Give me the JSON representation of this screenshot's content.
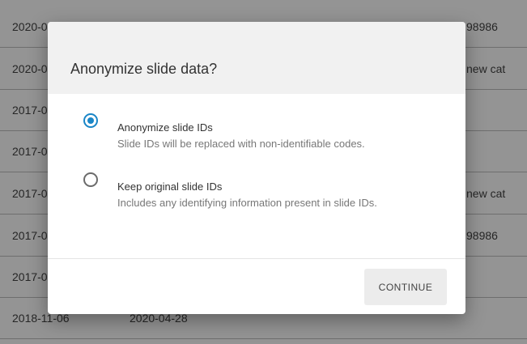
{
  "background_table": {
    "rows": [
      {
        "col1": "2020-0",
        "col2": "",
        "col3": "98986"
      },
      {
        "col1": "2020-0",
        "col2": "",
        "col3": "new cat"
      },
      {
        "col1": "2017-0",
        "col2": "",
        "col3": ""
      },
      {
        "col1": "2017-0",
        "col2": "",
        "col3": ""
      },
      {
        "col1": "2017-0",
        "col2": "",
        "col3": "new cat"
      },
      {
        "col1": "2017-0",
        "col2": "",
        "col3": "98986"
      },
      {
        "col1": "2017-0",
        "col2": "",
        "col3": ""
      },
      {
        "col1": "2018-11-06",
        "col2": "2020-04-28",
        "col3": ""
      }
    ]
  },
  "dialog": {
    "title": "Anonymize slide data?",
    "options": [
      {
        "label": "Anonymize slide IDs",
        "description": "Slide IDs will be replaced with non-identifiable codes.",
        "selected": true
      },
      {
        "label": "Keep original slide IDs",
        "description": "Includes any identifying information present in slide IDs.",
        "selected": false
      }
    ],
    "continue_label": "CONTINUE"
  },
  "colors": {
    "accent": "#1a86c7",
    "overlay": "rgba(0,0,0,0.42)"
  }
}
